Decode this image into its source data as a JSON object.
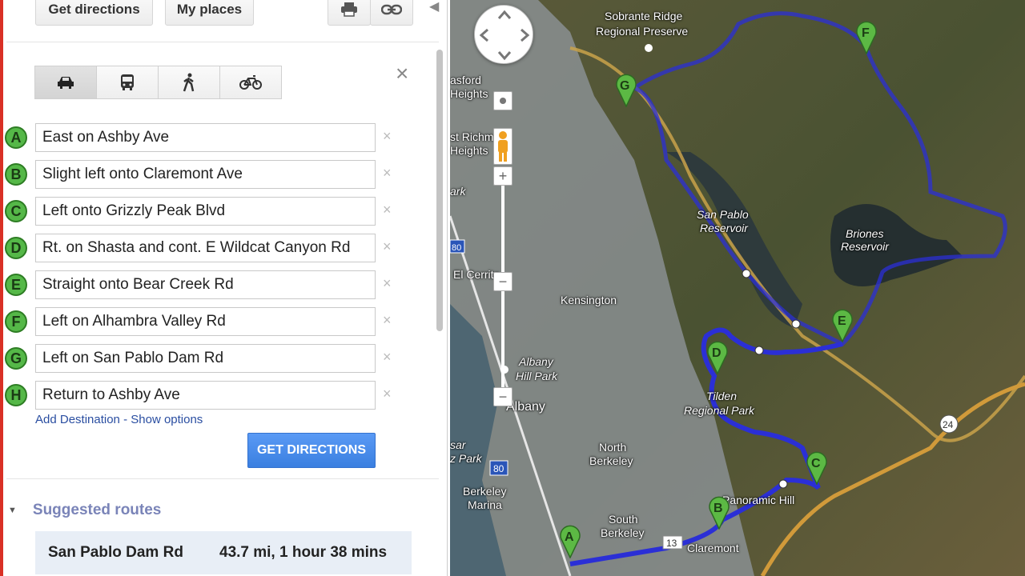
{
  "toolbar": {
    "get_directions": "Get directions",
    "my_places": "My places",
    "print_icon": "print-icon",
    "link_icon": "link-icon"
  },
  "travel_modes": [
    "driving-icon",
    "transit-icon",
    "walking-icon",
    "bicycling-icon"
  ],
  "close_symbol": "×",
  "remove_symbol": "×",
  "stops": [
    {
      "letter": "A",
      "value": "East on Ashby Ave"
    },
    {
      "letter": "B",
      "value": "Slight left onto Claremont Ave"
    },
    {
      "letter": "C",
      "value": "Left onto Grizzly Peak Blvd"
    },
    {
      "letter": "D",
      "value": "Rt. on Shasta and cont. E Wildcat Canyon Rd"
    },
    {
      "letter": "E",
      "value": "Straight onto Bear Creek Rd"
    },
    {
      "letter": "F",
      "value": "Left on Alhambra Valley Rd"
    },
    {
      "letter": "G",
      "value": "Left on San Pablo Dam Rd"
    },
    {
      "letter": "H",
      "value": "Return to Ashby Ave"
    }
  ],
  "links": {
    "add_destination": "Add Destination",
    "separator": " - ",
    "show_options": "Show options"
  },
  "get_directions_button": "GET DIRECTIONS",
  "suggested": {
    "heading": "Suggested routes",
    "route_name": "San Pablo Dam Rd",
    "route_info": "43.7 mi, 1 hour 38 mins"
  },
  "map": {
    "labels": {
      "sobrante": "Sobrante Ridge",
      "sobrante2": "Regional Preserve",
      "sanpablo": "San Pablo",
      "sanpablo2": "Reservoir",
      "briones": "Briones",
      "briones2": "Reservoir",
      "kensington": "Kensington",
      "elcerrito": "El Cerrito",
      "albanyhill": "Albany",
      "albanyhill2": "Hill Park",
      "albany": "Albany",
      "tilden": "Tilden",
      "tilden2": "Regional Park",
      "northberkeley": "North",
      "northberkeley2": "Berkeley",
      "southberkeley": "South",
      "southberkeley2": "Berkeley",
      "berkeleymarina": "Berkeley",
      "berkeleymarina2": "Marina",
      "claremont": "Claremont",
      "panoramic": "Panoramic Hill",
      "hasford": "asford",
      "heights": "Heights",
      "eastrich": "st Richm",
      "eastrich2": "Heights",
      "park": "ark",
      "osar": "sar",
      "zpark": "z Park",
      "hwy80": "80",
      "hwy80b": "80",
      "hwy13": "13",
      "hwy24": "24"
    },
    "zoom_in": "+",
    "zoom_out": "−",
    "route_color": "#2b2fd6"
  }
}
